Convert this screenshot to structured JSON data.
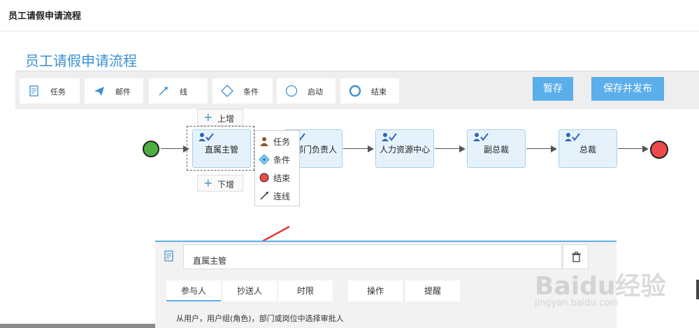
{
  "header": {
    "title": "员工请假申请流程"
  },
  "page": {
    "title": "员工请假申请流程"
  },
  "toolbar": {
    "tools": [
      {
        "label": "任务",
        "icon": "task-icon"
      },
      {
        "label": "邮件",
        "icon": "mail-icon"
      },
      {
        "label": "线",
        "icon": "line-icon"
      },
      {
        "label": "条件",
        "icon": "condition-icon"
      },
      {
        "label": "启动",
        "icon": "start-icon"
      },
      {
        "label": "结束",
        "icon": "end-icon"
      }
    ],
    "save_label": "暂存",
    "publish_label": "保存并发布"
  },
  "flow": {
    "nodes": [
      {
        "label": "直属主管"
      },
      {
        "label": "部门负责人"
      },
      {
        "label": "人力资源中心"
      },
      {
        "label": "副总裁"
      },
      {
        "label": "总裁"
      }
    ],
    "add_above": "上增",
    "add_below": "下增",
    "context_menu": [
      {
        "label": "任务",
        "icon": "person-icon"
      },
      {
        "label": "条件",
        "icon": "condition-icon"
      },
      {
        "label": "结束",
        "icon": "end-circle-icon"
      },
      {
        "label": "连线",
        "icon": "connect-line-icon"
      }
    ]
  },
  "panel": {
    "node_name": "直属主管",
    "tabs": [
      "参与人",
      "抄送人",
      "时限",
      "操作",
      "提醒"
    ],
    "active_tab": "参与人",
    "hint": "从用户，用户组(角色)，部门或岗位中选择审批人"
  },
  "watermark": {
    "brand": "Baidu经验",
    "url": "jingyan.baidu.com"
  },
  "colors": {
    "accent": "#5aaeea",
    "title": "#3a8fd4",
    "start": "#4caf3f",
    "end": "#ee4a4a",
    "arrow": "#e53935"
  }
}
